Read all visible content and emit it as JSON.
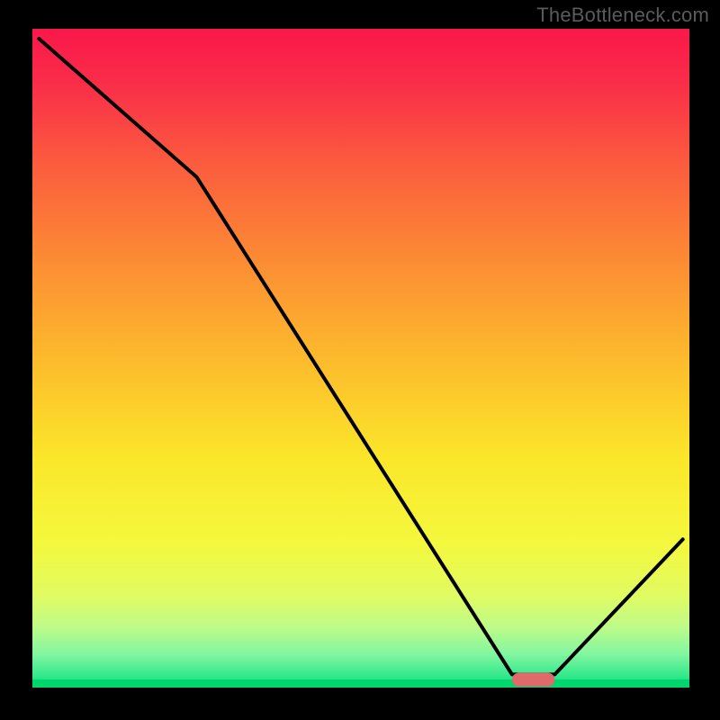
{
  "watermark": "TheBottleneck.com",
  "chart_data": {
    "type": "line",
    "title": "",
    "xlabel": "",
    "ylabel": "",
    "xlim": [
      0,
      100
    ],
    "ylim": [
      0,
      100
    ],
    "grid": false,
    "legend": false,
    "series": [
      {
        "name": "curve",
        "x": [
          1,
          25,
          73,
          79.5,
          99
        ],
        "values": [
          98.5,
          77.5,
          2,
          2,
          22.5
        ]
      }
    ],
    "marker": {
      "name": "red-marker",
      "x_range": [
        73,
        79.5
      ],
      "y": 1.2,
      "color": "#e0696c",
      "thickness": 2.1
    },
    "colors": {
      "frame": "#000000",
      "baseline": "#00d66b",
      "gradient_stops": [
        {
          "offset": 0.0,
          "color": "#f9184a"
        },
        {
          "offset": 0.08,
          "color": "#fa2c49"
        },
        {
          "offset": 0.2,
          "color": "#fb5a3e"
        },
        {
          "offset": 0.35,
          "color": "#fc8b34"
        },
        {
          "offset": 0.5,
          "color": "#fcba2c"
        },
        {
          "offset": 0.65,
          "color": "#fbe62a"
        },
        {
          "offset": 0.78,
          "color": "#f4f83d"
        },
        {
          "offset": 0.86,
          "color": "#e1fb62"
        },
        {
          "offset": 0.91,
          "color": "#bcfb8a"
        },
        {
          "offset": 0.95,
          "color": "#80f6a0"
        },
        {
          "offset": 0.985,
          "color": "#2de78b"
        },
        {
          "offset": 1.0,
          "color": "#00d66b"
        }
      ]
    }
  }
}
